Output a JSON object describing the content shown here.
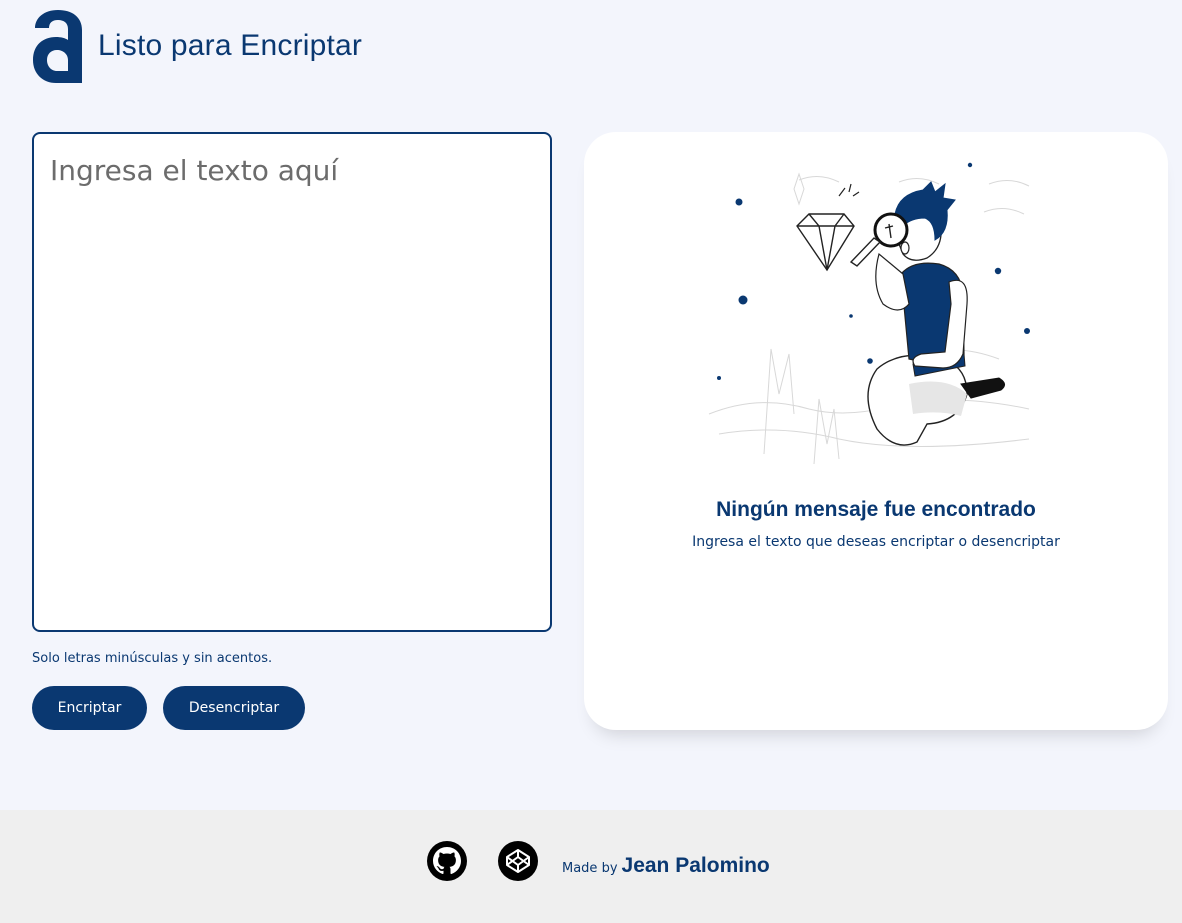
{
  "header": {
    "logo_icon": "alura-a-logo-icon",
    "title": "Listo para Encriptar"
  },
  "input": {
    "placeholder": "Ingresa el texto aquí",
    "value": ""
  },
  "hint": "Solo letras minúsculas y sin acentos.",
  "buttons": {
    "encrypt_label": "Encriptar",
    "decrypt_label": "Desencriptar"
  },
  "result": {
    "illustration_icon": "boy-with-magnifier-illustration",
    "title": "Ningún mensaje fue encontrado",
    "subtitle": "Ingresa el texto que deseas encriptar o desencriptar"
  },
  "footer": {
    "github_icon": "github-icon",
    "codepen_icon": "codepen-icon",
    "made_by_label": "Made by",
    "author_name": "Jean Palomino"
  },
  "colors": {
    "primary": "#0A3871",
    "background": "#F3F5FC",
    "footer_bg": "#EFEFEF",
    "card_bg": "#FFFFFF"
  }
}
